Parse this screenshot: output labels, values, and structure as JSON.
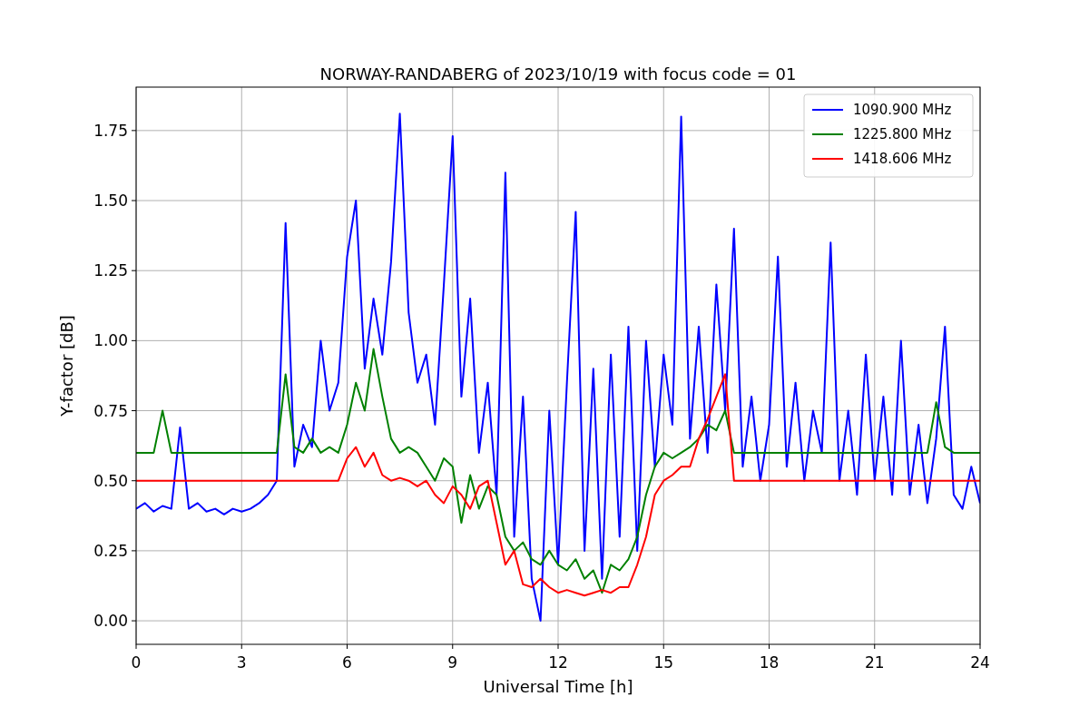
{
  "figure": {
    "chart_data": {
      "type": "line",
      "title": "NORWAY-RANDABERG of 2023/10/19 with focus code = 01",
      "xlabel": "Universal Time [h]",
      "ylabel": "Y-factor [dB]",
      "x": [
        0,
        0.25,
        0.5,
        0.75,
        1,
        1.25,
        1.5,
        1.75,
        2,
        2.25,
        2.5,
        2.75,
        3,
        3.25,
        3.5,
        3.75,
        4,
        4.25,
        4.5,
        4.75,
        5,
        5.25,
        5.5,
        5.75,
        6,
        6.25,
        6.5,
        6.75,
        7,
        7.25,
        7.5,
        7.75,
        8,
        8.25,
        8.5,
        8.75,
        9,
        9.25,
        9.5,
        9.75,
        10,
        10.25,
        10.5,
        10.75,
        11,
        11.25,
        11.5,
        11.75,
        12,
        12.25,
        12.5,
        12.75,
        13,
        13.25,
        13.5,
        13.75,
        14,
        14.25,
        14.5,
        14.75,
        15,
        15.25,
        15.5,
        15.75,
        16,
        16.25,
        16.5,
        16.75,
        17,
        17.25,
        17.5,
        17.75,
        18,
        18.25,
        18.5,
        18.75,
        19,
        19.25,
        19.5,
        19.75,
        20,
        20.25,
        20.5,
        20.75,
        21,
        21.25,
        21.5,
        21.75,
        22,
        22.25,
        22.5,
        22.75,
        23,
        23.25,
        23.5,
        23.75,
        24
      ],
      "series": [
        {
          "name": "1090.900 MHz",
          "color": "#0000ff",
          "values": [
            0.4,
            0.42,
            0.39,
            0.41,
            0.4,
            0.69,
            0.4,
            0.42,
            0.39,
            0.4,
            0.38,
            0.4,
            0.39,
            0.4,
            0.42,
            0.45,
            0.5,
            1.42,
            0.55,
            0.7,
            0.62,
            1.0,
            0.75,
            0.85,
            1.3,
            1.5,
            0.9,
            1.15,
            0.95,
            1.28,
            1.81,
            1.1,
            0.85,
            0.95,
            0.7,
            1.2,
            1.73,
            0.8,
            1.15,
            0.6,
            0.85,
            0.45,
            1.6,
            0.3,
            0.8,
            0.15,
            0.0,
            0.75,
            0.2,
            0.85,
            1.46,
            0.25,
            0.9,
            0.15,
            0.95,
            0.3,
            1.05,
            0.25,
            1.0,
            0.55,
            0.95,
            0.7,
            1.8,
            0.65,
            1.05,
            0.6,
            1.2,
            0.75,
            1.4,
            0.55,
            0.8,
            0.5,
            0.7,
            1.3,
            0.55,
            0.85,
            0.5,
            0.75,
            0.6,
            1.35,
            0.5,
            0.75,
            0.45,
            0.95,
            0.5,
            0.8,
            0.45,
            1.0,
            0.45,
            0.7,
            0.42,
            0.65,
            1.05,
            0.45,
            0.4,
            0.55,
            0.42
          ]
        },
        {
          "name": "1225.800 MHz",
          "color": "#008000",
          "values": [
            0.6,
            0.6,
            0.6,
            0.75,
            0.6,
            0.6,
            0.6,
            0.6,
            0.6,
            0.6,
            0.6,
            0.6,
            0.6,
            0.6,
            0.6,
            0.6,
            0.6,
            0.88,
            0.62,
            0.6,
            0.65,
            0.6,
            0.62,
            0.6,
            0.7,
            0.85,
            0.75,
            0.97,
            0.8,
            0.65,
            0.6,
            0.62,
            0.6,
            0.55,
            0.5,
            0.58,
            0.55,
            0.35,
            0.52,
            0.4,
            0.48,
            0.45,
            0.3,
            0.25,
            0.28,
            0.22,
            0.2,
            0.25,
            0.2,
            0.18,
            0.22,
            0.15,
            0.18,
            0.1,
            0.2,
            0.18,
            0.22,
            0.3,
            0.45,
            0.55,
            0.6,
            0.58,
            0.6,
            0.62,
            0.65,
            0.7,
            0.68,
            0.75,
            0.6,
            0.6,
            0.6,
            0.6,
            0.6,
            0.6,
            0.6,
            0.6,
            0.6,
            0.6,
            0.6,
            0.6,
            0.6,
            0.6,
            0.6,
            0.6,
            0.6,
            0.6,
            0.6,
            0.6,
            0.6,
            0.6,
            0.6,
            0.78,
            0.62,
            0.6,
            0.6,
            0.6,
            0.6
          ]
        },
        {
          "name": "1418.606 MHz",
          "color": "#ff0000",
          "values": [
            0.5,
            0.5,
            0.5,
            0.5,
            0.5,
            0.5,
            0.5,
            0.5,
            0.5,
            0.5,
            0.5,
            0.5,
            0.5,
            0.5,
            0.5,
            0.5,
            0.5,
            0.5,
            0.5,
            0.5,
            0.5,
            0.5,
            0.5,
            0.5,
            0.58,
            0.62,
            0.55,
            0.6,
            0.52,
            0.5,
            0.51,
            0.5,
            0.48,
            0.5,
            0.45,
            0.42,
            0.48,
            0.45,
            0.4,
            0.48,
            0.5,
            0.35,
            0.2,
            0.25,
            0.13,
            0.12,
            0.15,
            0.12,
            0.1,
            0.11,
            0.1,
            0.09,
            0.1,
            0.11,
            0.1,
            0.12,
            0.12,
            0.2,
            0.3,
            0.45,
            0.5,
            0.52,
            0.55,
            0.55,
            0.65,
            0.72,
            0.8,
            0.88,
            0.5,
            0.5,
            0.5,
            0.5,
            0.5,
            0.5,
            0.5,
            0.5,
            0.5,
            0.5,
            0.5,
            0.5,
            0.5,
            0.5,
            0.5,
            0.5,
            0.5,
            0.5,
            0.5,
            0.5,
            0.5,
            0.5,
            0.5,
            0.5,
            0.5,
            0.5,
            0.5,
            0.5,
            0.5
          ]
        }
      ],
      "grid": true,
      "legend": true,
      "xlim": [
        0,
        24
      ],
      "ylim": [
        -0.084,
        1.905
      ],
      "xticks": [
        0,
        3,
        6,
        9,
        12,
        15,
        18,
        21,
        24
      ],
      "yticks": [
        {
          "value": 0,
          "label": "0.00"
        },
        {
          "value": 0.25,
          "label": "0.25"
        },
        {
          "value": 0.5,
          "label": "0.50"
        },
        {
          "value": 0.75,
          "label": "0.75"
        },
        {
          "value": 1,
          "label": "1.00"
        },
        {
          "value": 1.25,
          "label": "1.25"
        },
        {
          "value": 1.5,
          "label": "1.50"
        },
        {
          "value": 1.75,
          "label": "1.75"
        }
      ]
    }
  }
}
